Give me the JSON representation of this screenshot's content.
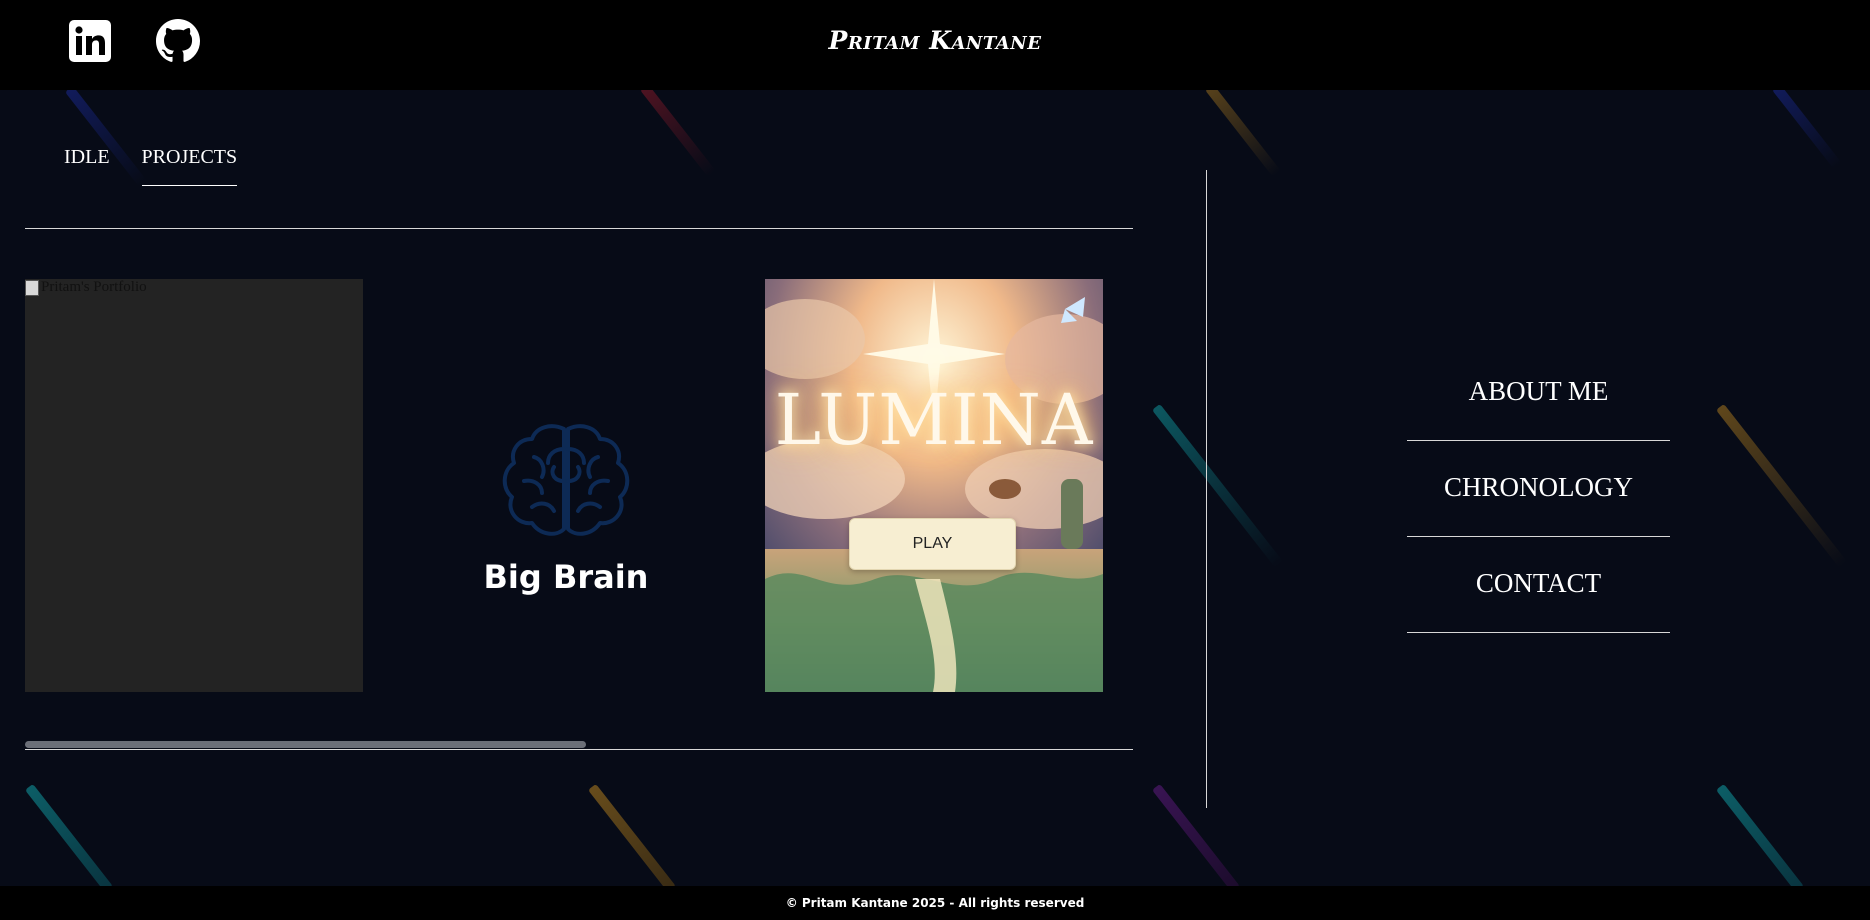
{
  "header": {
    "brand": "Pritam Kantane",
    "social": [
      {
        "name": "linkedin",
        "icon": "linkedin-icon"
      },
      {
        "name": "github",
        "icon": "github-icon"
      }
    ]
  },
  "tabs": [
    {
      "label": "IDLE",
      "active": false
    },
    {
      "label": "PROJECTS",
      "active": true
    }
  ],
  "projects": {
    "broken_image_alt": "Pritam's Portfolio",
    "brain_title": "Big Brain",
    "brain_icon": "brain-icon",
    "lumina_title": "LUMINA",
    "lumina_play": "PLAY"
  },
  "nav": {
    "items": [
      "ABOUT ME",
      "CHRONOLOGY",
      "CONTACT"
    ]
  },
  "footer": {
    "text": "© Pritam Kantane 2025 - All rights reserved"
  },
  "colors": {
    "background": "#070b17",
    "header": "#000000",
    "brain_accent": "#0d2a55",
    "streak_teal": "#0f8a91",
    "streak_gold": "#a8781f",
    "streak_purple": "#5a1a7a",
    "streak_blue": "#1c2ca0",
    "streak_red": "#8a1a2a"
  }
}
